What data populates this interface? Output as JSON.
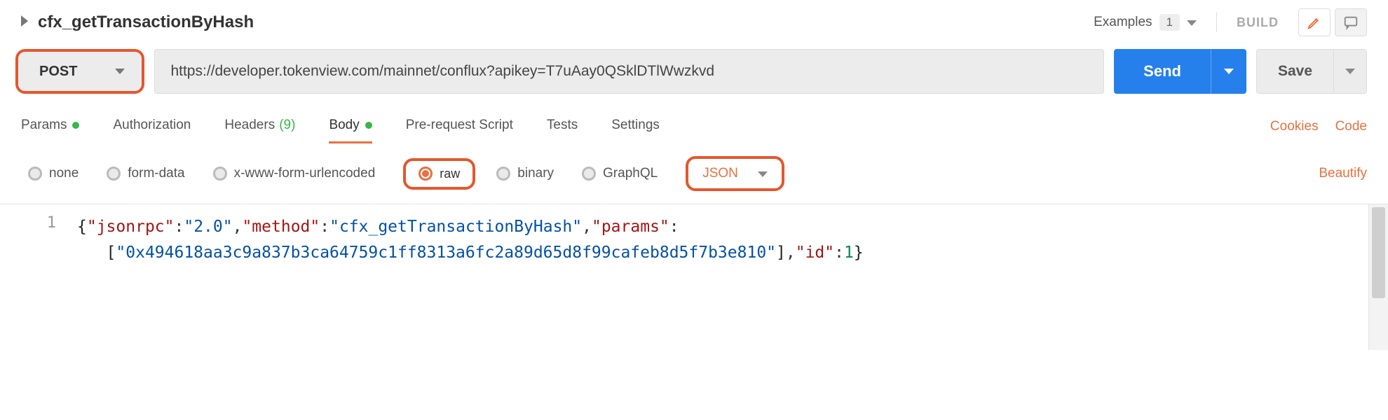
{
  "header": {
    "title": "cfx_getTransactionByHash",
    "examples_label": "Examples",
    "examples_count": "1",
    "build_label": "BUILD"
  },
  "request": {
    "method": "POST",
    "url": "https://developer.tokenview.com/mainnet/conflux?apikey=T7uAay0QSklDTlWwzkvd",
    "send_label": "Send",
    "save_label": "Save"
  },
  "tabs": {
    "items": [
      "Params",
      "Authorization",
      "Headers",
      "Body",
      "Pre-request Script",
      "Tests",
      "Settings"
    ],
    "headers_count": "(9)",
    "active": "Body",
    "cookies_label": "Cookies",
    "code_label": "Code"
  },
  "body": {
    "types": [
      "none",
      "form-data",
      "x-www-form-urlencoded",
      "raw",
      "binary",
      "GraphQL"
    ],
    "selected_type": "raw",
    "format": "JSON",
    "beautify_label": "Beautify"
  },
  "editor": {
    "line_number": "1",
    "json_payload": {
      "jsonrpc": "2.0",
      "method": "cfx_getTransactionByHash",
      "params": [
        "0x494618aa3c9a837b3ca64759c1ff8313a6fc2a89d65d8f99cafeb8d5f7b3e810"
      ],
      "id": 1
    },
    "tokens": {
      "k_jsonrpc": "\"jsonrpc\"",
      "v_jsonrpc": "\"2.0\"",
      "k_method": "\"method\"",
      "v_method": "\"cfx_getTransactionByHash\"",
      "k_params": "\"params\"",
      "v_param0": "\"0x494618aa3c9a837b3ca64759c1ff8313a6fc2a89d65d8f99cafeb8d5f7b3e810\"",
      "k_id": "\"id\"",
      "v_id": "1"
    }
  }
}
